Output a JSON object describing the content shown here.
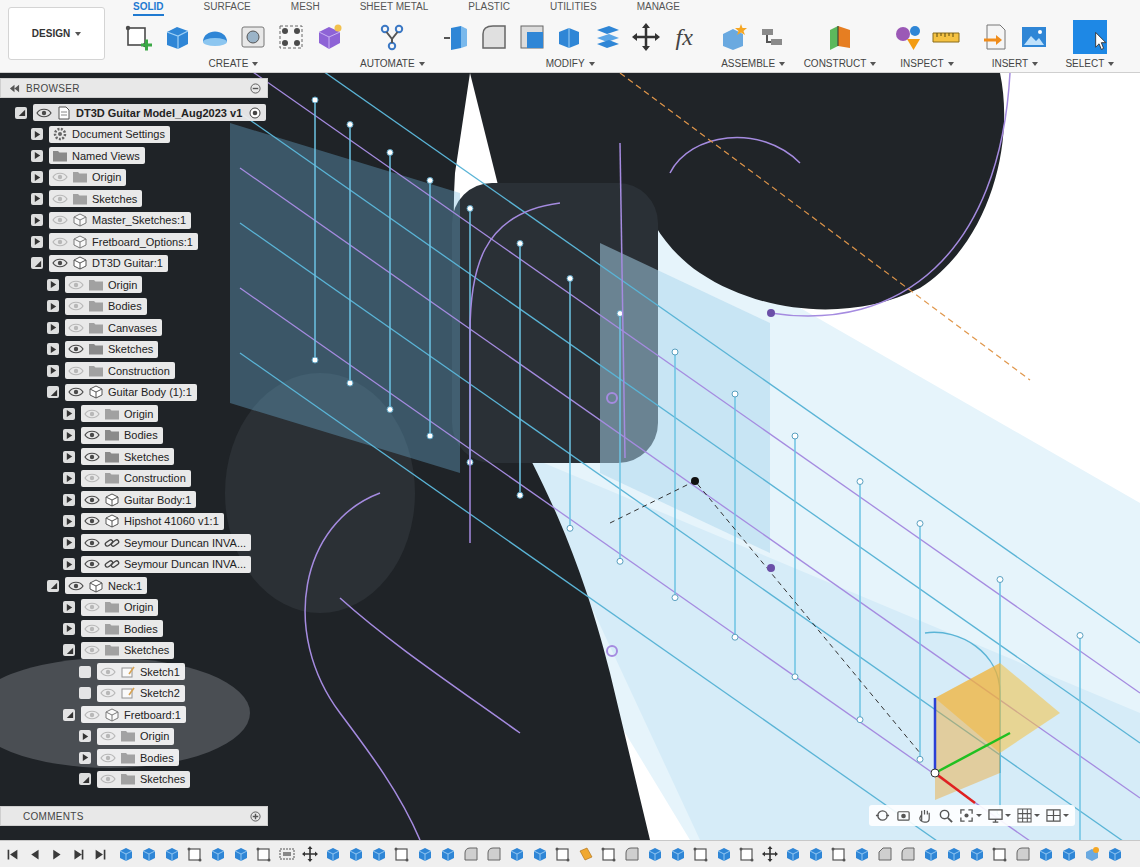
{
  "toolbar": {
    "workspace": "DESIGN",
    "tabs": [
      {
        "label": "SOLID",
        "selected": true
      },
      {
        "label": "SURFACE",
        "selected": false
      },
      {
        "label": "MESH",
        "selected": false
      },
      {
        "label": "SHEET METAL",
        "selected": false
      },
      {
        "label": "PLASTIC",
        "selected": false
      },
      {
        "label": "UTILITIES",
        "selected": false
      },
      {
        "label": "MANAGE",
        "selected": false
      }
    ],
    "groups": [
      {
        "label": "CREATE",
        "tools": [
          {
            "kind": "sketch"
          },
          {
            "kind": "extrude"
          },
          {
            "kind": "revolve"
          },
          {
            "kind": "hole"
          },
          {
            "kind": "pattern"
          },
          {
            "kind": "form"
          }
        ]
      },
      {
        "label": "AUTOMATE",
        "tools": [
          {
            "kind": "automate"
          }
        ]
      },
      {
        "label": "MODIFY",
        "tools": [
          {
            "kind": "presspull"
          },
          {
            "kind": "fillet"
          },
          {
            "kind": "shell"
          },
          {
            "kind": "combine"
          },
          {
            "kind": "align"
          },
          {
            "kind": "move"
          },
          {
            "kind": "formula",
            "glyph": "fx"
          }
        ]
      },
      {
        "label": "ASSEMBLE",
        "tools": [
          {
            "kind": "newcomp"
          },
          {
            "kind": "joint"
          }
        ]
      },
      {
        "label": "CONSTRUCT",
        "tools": [
          {
            "kind": "plane"
          }
        ]
      },
      {
        "label": "INSPECT",
        "tools": [
          {
            "kind": "analysis"
          },
          {
            "kind": "measure"
          }
        ]
      },
      {
        "label": "INSERT",
        "tools": [
          {
            "kind": "derive"
          },
          {
            "kind": "canvas"
          }
        ]
      },
      {
        "label": "SELECT",
        "tools": [
          {
            "kind": "select"
          }
        ]
      }
    ]
  },
  "browser": {
    "title": "BROWSER",
    "items": [
      {
        "label": "DT3D Guitar Model_Aug2023 v1",
        "depth": 0,
        "kind": "root",
        "expandable": true,
        "expanded": true,
        "visible": true,
        "active": true
      },
      {
        "label": "Document Settings",
        "depth": 1,
        "kind": "settings",
        "expandable": true,
        "expanded": false,
        "visible": true,
        "active": false
      },
      {
        "label": "Named Views",
        "depth": 1,
        "kind": "views",
        "expandable": true,
        "expanded": false,
        "visible": true,
        "active": false
      },
      {
        "label": "Origin",
        "depth": 1,
        "kind": "folder",
        "expandable": true,
        "expanded": false,
        "visible": false,
        "active": false
      },
      {
        "label": "Sketches",
        "depth": 1,
        "kind": "folder",
        "expandable": true,
        "expanded": false,
        "visible": false,
        "active": false
      },
      {
        "label": "Master_Sketches:1",
        "depth": 1,
        "kind": "component",
        "expandable": true,
        "expanded": false,
        "visible": false,
        "active": false
      },
      {
        "label": "Fretboard_Options:1",
        "depth": 1,
        "kind": "component",
        "expandable": true,
        "expanded": false,
        "visible": false,
        "active": false
      },
      {
        "label": "DT3D Guitar:1",
        "depth": 1,
        "kind": "component",
        "expandable": true,
        "expanded": true,
        "visible": true,
        "active": false
      },
      {
        "label": "Origin",
        "depth": 2,
        "kind": "folder",
        "expandable": true,
        "expanded": false,
        "visible": false,
        "active": false
      },
      {
        "label": "Bodies",
        "depth": 2,
        "kind": "folder",
        "expandable": true,
        "expanded": false,
        "visible": false,
        "active": false
      },
      {
        "label": "Canvases",
        "depth": 2,
        "kind": "folder",
        "expandable": true,
        "expanded": false,
        "visible": false,
        "active": false
      },
      {
        "label": "Sketches",
        "depth": 2,
        "kind": "folder",
        "expandable": true,
        "expanded": false,
        "visible": true,
        "active": false
      },
      {
        "label": "Construction",
        "depth": 2,
        "kind": "folder",
        "expandable": true,
        "expanded": false,
        "visible": false,
        "active": false
      },
      {
        "label": "Guitar Body (1):1",
        "depth": 2,
        "kind": "component",
        "expandable": true,
        "expanded": true,
        "visible": true,
        "active": false
      },
      {
        "label": "Origin",
        "depth": 3,
        "kind": "folder",
        "expandable": true,
        "expanded": false,
        "visible": false,
        "active": false
      },
      {
        "label": "Bodies",
        "depth": 3,
        "kind": "folder",
        "expandable": true,
        "expanded": false,
        "visible": true,
        "active": false
      },
      {
        "label": "Sketches",
        "depth": 3,
        "kind": "folder",
        "expandable": true,
        "expanded": false,
        "visible": true,
        "active": false
      },
      {
        "label": "Construction",
        "depth": 3,
        "kind": "folder",
        "expandable": true,
        "expanded": false,
        "visible": false,
        "active": false
      },
      {
        "label": "Guitar Body:1",
        "depth": 3,
        "kind": "component",
        "expandable": true,
        "expanded": false,
        "visible": true,
        "active": false
      },
      {
        "label": "Hipshot 41060 v1:1",
        "depth": 3,
        "kind": "component",
        "expandable": true,
        "expanded": false,
        "visible": true,
        "active": false
      },
      {
        "label": "Seymour Duncan INVA...",
        "depth": 3,
        "kind": "linked",
        "expandable": true,
        "expanded": false,
        "visible": true,
        "active": false
      },
      {
        "label": "Seymour Duncan INVA...",
        "depth": 3,
        "kind": "linked",
        "expandable": true,
        "expanded": false,
        "visible": true,
        "active": false
      },
      {
        "label": "Neck:1",
        "depth": 2,
        "kind": "component",
        "expandable": true,
        "expanded": true,
        "visible": true,
        "active": false
      },
      {
        "label": "Origin",
        "depth": 3,
        "kind": "folder",
        "expandable": true,
        "expanded": false,
        "visible": false,
        "active": false
      },
      {
        "label": "Bodies",
        "depth": 3,
        "kind": "folder",
        "expandable": true,
        "expanded": false,
        "visible": false,
        "active": false
      },
      {
        "label": "Sketches",
        "depth": 3,
        "kind": "folder",
        "expandable": true,
        "expanded": true,
        "visible": false,
        "active": false
      },
      {
        "label": "Sketch1",
        "depth": 4,
        "kind": "sketch",
        "expandable": false,
        "expanded": false,
        "visible": false,
        "active": false
      },
      {
        "label": "Sketch2",
        "depth": 4,
        "kind": "sketch",
        "expandable": false,
        "expanded": false,
        "visible": false,
        "active": false
      },
      {
        "label": "Fretboard:1",
        "depth": 3,
        "kind": "component",
        "expandable": true,
        "expanded": true,
        "visible": false,
        "active": false
      },
      {
        "label": "Origin",
        "depth": 4,
        "kind": "folder",
        "expandable": true,
        "expanded": false,
        "visible": false,
        "active": false
      },
      {
        "label": "Bodies",
        "depth": 4,
        "kind": "folder",
        "expandable": true,
        "expanded": false,
        "visible": false,
        "active": false
      },
      {
        "label": "Sketches",
        "depth": 4,
        "kind": "folder",
        "expandable": true,
        "expanded": true,
        "visible": false,
        "active": false
      }
    ]
  },
  "comments": {
    "title": "COMMENTS"
  },
  "timeline": {
    "features": [
      "extrude",
      "extrude",
      "extrude",
      "sketch",
      "extrude",
      "extrude",
      "sketch",
      "group",
      "move",
      "extrude",
      "extrude",
      "extrude",
      "sketch",
      "extrude",
      "extrude",
      "fillet",
      "fillet",
      "extrude",
      "extrude",
      "sketch",
      "plane",
      "sketch",
      "fillet",
      "extrude",
      "extrude",
      "sketch",
      "extrude",
      "sketch",
      "move",
      "extrude",
      "extrude",
      "sketch",
      "extrude",
      "chamfer",
      "fillet",
      "extrude",
      "extrude",
      "extrude",
      "sketch",
      "fillet",
      "extrude",
      "extrude",
      "component",
      "extrude"
    ]
  }
}
